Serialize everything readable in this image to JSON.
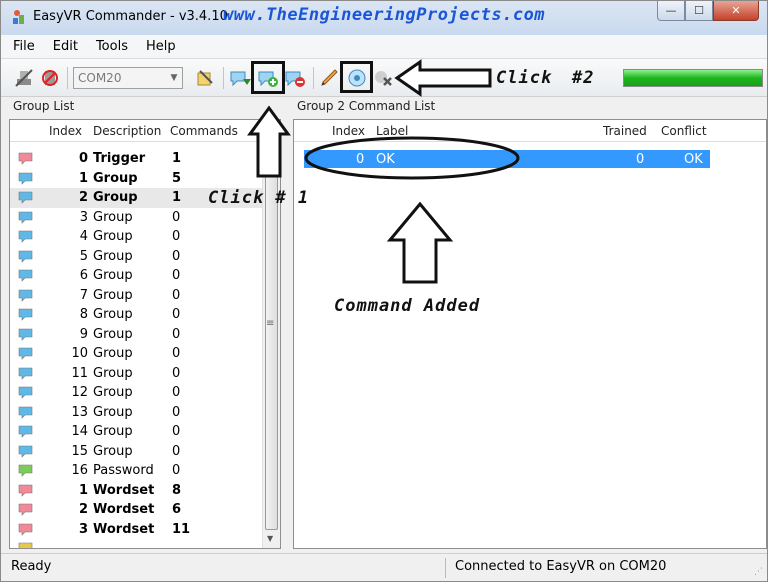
{
  "window": {
    "title": "EasyVR Commander - v3.4.10",
    "watermark": "www.TheEngineeringProjects.com",
    "controls": {
      "minimize": "—",
      "maximize": "☐",
      "close": "✕"
    }
  },
  "menu": [
    "File",
    "Edit",
    "Tools",
    "Help"
  ],
  "toolbar": {
    "port_value": "COM20",
    "progress_fraction": 1.0,
    "icons": [
      "disconnect-icon",
      "stop-connection-icon",
      "settings-icon",
      "add-group-icon",
      "add-command-icon",
      "remove-command-icon",
      "edit-icon",
      "train-command-icon",
      "erase-icon",
      "test-icon"
    ]
  },
  "group_list": {
    "label": "Group List",
    "columns": {
      "index": "Index",
      "description": "Description",
      "commands": "Commands"
    },
    "rows": [
      {
        "index": "0",
        "description": "Trigger",
        "commands": "1",
        "bold": true,
        "color": "#f08a98"
      },
      {
        "index": "1",
        "description": "Group",
        "commands": "5",
        "bold": true,
        "color": "#5fb8e6"
      },
      {
        "index": "2",
        "description": "Group",
        "commands": "1",
        "bold": true,
        "color": "#5fb8e6",
        "selected": true
      },
      {
        "index": "3",
        "description": "Group",
        "commands": "0",
        "color": "#5fb8e6"
      },
      {
        "index": "4",
        "description": "Group",
        "commands": "0",
        "color": "#5fb8e6"
      },
      {
        "index": "5",
        "description": "Group",
        "commands": "0",
        "color": "#5fb8e6"
      },
      {
        "index": "6",
        "description": "Group",
        "commands": "0",
        "color": "#5fb8e6"
      },
      {
        "index": "7",
        "description": "Group",
        "commands": "0",
        "color": "#5fb8e6"
      },
      {
        "index": "8",
        "description": "Group",
        "commands": "0",
        "color": "#5fb8e6"
      },
      {
        "index": "9",
        "description": "Group",
        "commands": "0",
        "color": "#5fb8e6"
      },
      {
        "index": "10",
        "description": "Group",
        "commands": "0",
        "color": "#5fb8e6"
      },
      {
        "index": "11",
        "description": "Group",
        "commands": "0",
        "color": "#5fb8e6"
      },
      {
        "index": "12",
        "description": "Group",
        "commands": "0",
        "color": "#5fb8e6"
      },
      {
        "index": "13",
        "description": "Group",
        "commands": "0",
        "color": "#5fb8e6"
      },
      {
        "index": "14",
        "description": "Group",
        "commands": "0",
        "color": "#5fb8e6"
      },
      {
        "index": "15",
        "description": "Group",
        "commands": "0",
        "color": "#5fb8e6"
      },
      {
        "index": "16",
        "description": "Password",
        "commands": "0",
        "color": "#7dcc5a"
      },
      {
        "index": "1",
        "description": "Wordset",
        "commands": "8",
        "bold": true,
        "color": "#f08a98"
      },
      {
        "index": "2",
        "description": "Wordset",
        "commands": "6",
        "bold": true,
        "color": "#f08a98"
      },
      {
        "index": "3",
        "description": "Wordset",
        "commands": "11",
        "bold": true,
        "color": "#f08a98"
      },
      {
        "index": "",
        "description": "",
        "commands": "",
        "color": "#e8c84a"
      }
    ]
  },
  "command_list": {
    "label": "Group 2 Command List",
    "columns": {
      "index": "Index",
      "label": "Label",
      "trained": "Trained",
      "conflict": "Conflict"
    },
    "rows": [
      {
        "index": "0",
        "label": "OK",
        "trained": "0",
        "conflict": "OK"
      }
    ]
  },
  "status": {
    "left": "Ready",
    "right": "Connected to EasyVR on COM20"
  },
  "annotations": {
    "click1": "Click # 1",
    "click2_a": "Click",
    "click2_b": "#2",
    "command_added": "Command Added"
  }
}
